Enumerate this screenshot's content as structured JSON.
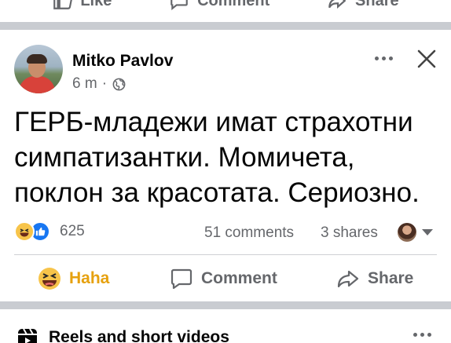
{
  "previous_post": {
    "actions": [
      "Like",
      "Comment",
      "Share"
    ]
  },
  "post": {
    "author": "Mitko Pavlov",
    "time": "6 m",
    "dot": "·",
    "text": "ГЕРБ-младежи имат страхотни симпатизантки. Момичета, поклон за красотата. Сериозно.",
    "reaction_count": "625",
    "comments_count": "51 comments",
    "shares_count": "3 shares",
    "actions": {
      "haha": "Haha",
      "comment": "Comment",
      "share": "Share"
    }
  },
  "next_section": {
    "title": "Reels and short videos"
  },
  "colors": {
    "haha_accent": "#e6a10f",
    "like_blue": "#1877f2",
    "secondary_text": "#65676b",
    "separator": "#c9ccd1"
  },
  "icons": [
    "like-icon",
    "comment-icon",
    "share-icon",
    "globe-icon",
    "more-icon",
    "close-icon",
    "haha-reaction-icon",
    "like-reaction-icon",
    "reels-icon"
  ]
}
